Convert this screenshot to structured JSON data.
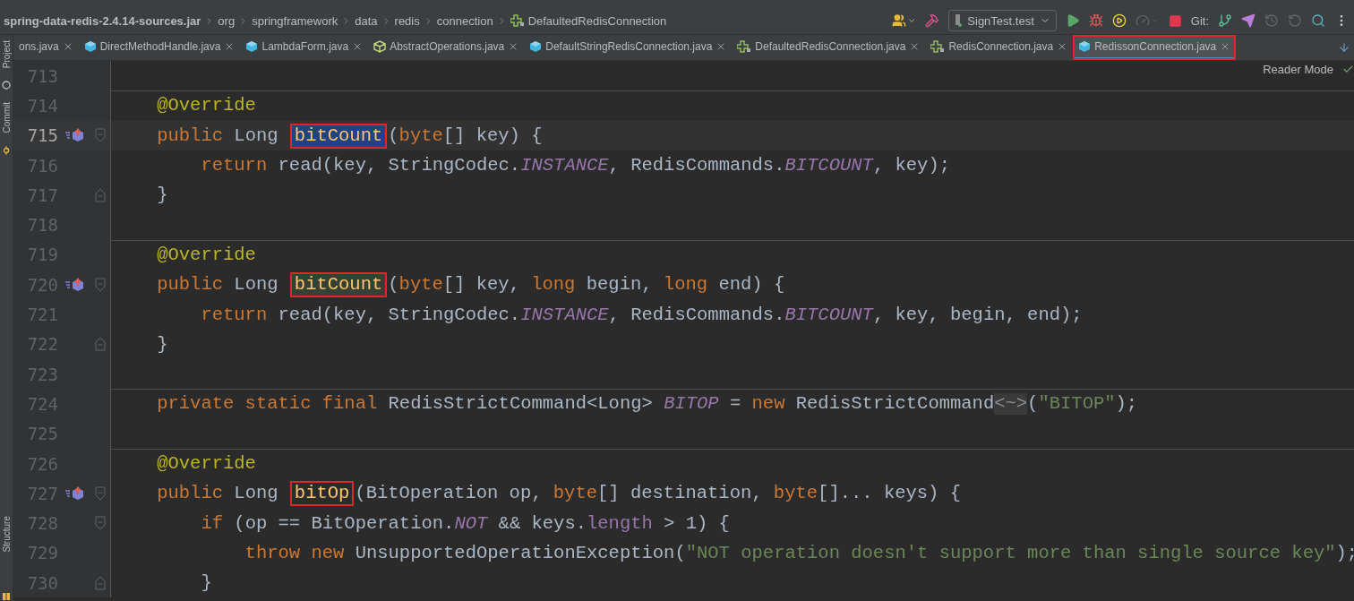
{
  "tool_strip": [
    {
      "label": "Project",
      "kind": "project"
    },
    {
      "label": "Commit",
      "kind": "commit"
    },
    {
      "label": "Structure",
      "kind": "structure"
    }
  ],
  "breadcrumbs": [
    {
      "label": "spring-data-redis-2.4.14-sources.jar",
      "kind": "jar"
    },
    {
      "label": "org",
      "kind": "package"
    },
    {
      "label": "springframework",
      "kind": "package"
    },
    {
      "label": "data",
      "kind": "package"
    },
    {
      "label": "redis",
      "kind": "package"
    },
    {
      "label": "connection",
      "kind": "package"
    },
    {
      "label": "DefaultedRedisConnection",
      "kind": "interface"
    }
  ],
  "toolbar": [
    {
      "kind": "users",
      "disabled": false
    },
    {
      "kind": "build",
      "disabled": false
    },
    {
      "kind": "run_config",
      "label": "SignTest.test",
      "disabled": false
    },
    {
      "kind": "run",
      "disabled": false
    },
    {
      "kind": "debug",
      "disabled": false
    },
    {
      "kind": "coverage",
      "disabled": false
    },
    {
      "kind": "profile",
      "disabled": true
    },
    {
      "kind": "stop",
      "disabled": false
    },
    {
      "kind": "git_label",
      "label": "Git:",
      "disabled": false
    },
    {
      "kind": "branch",
      "disabled": false
    },
    {
      "kind": "push",
      "disabled": false
    },
    {
      "kind": "history",
      "disabled": true
    },
    {
      "kind": "rollback",
      "disabled": true
    },
    {
      "kind": "search",
      "disabled": false
    },
    {
      "kind": "more",
      "disabled": false
    }
  ],
  "tabs": [
    {
      "label": "ons.java",
      "kind": "plain",
      "selected": false,
      "boxed": false
    },
    {
      "label": "DirectMethodHandle.java",
      "kind": "class",
      "selected": false,
      "boxed": false
    },
    {
      "label": "LambdaForm.java",
      "kind": "class",
      "selected": false,
      "boxed": false
    },
    {
      "label": "AbstractOperations.java",
      "kind": "abstract",
      "selected": false,
      "boxed": false
    },
    {
      "label": "DefaultStringRedisConnection.java",
      "kind": "class",
      "selected": false,
      "boxed": false
    },
    {
      "label": "DefaultedRedisConnection.java",
      "kind": "interface",
      "selected": false,
      "boxed": false
    },
    {
      "label": "RedisConnection.java",
      "kind": "interface",
      "selected": false,
      "boxed": false
    },
    {
      "label": "RedissonConnection.java",
      "kind": "class",
      "selected": true,
      "boxed": true
    }
  ],
  "reader_mode": "Reader Mode",
  "lines": [
    {
      "number": "713",
      "current": false,
      "separator_above": false,
      "implements": false,
      "fold_start": false,
      "fold_end": false
    },
    {
      "number": "714",
      "current": false,
      "separator_above": true,
      "implements": false,
      "fold_start": false,
      "fold_end": false,
      "tokens": [
        {
          "kind": "annotation",
          "text": "    @Override",
          "boxed": false
        }
      ]
    },
    {
      "number": "715",
      "current": true,
      "separator_above": false,
      "implements": true,
      "fold_start": true,
      "fold_end": false,
      "tokens": [
        {
          "kind": "keyword",
          "text": "    public ",
          "boxed": false
        },
        {
          "kind": "plain",
          "text": "Long ",
          "boxed": false
        },
        {
          "kind": "method_selected",
          "text": "bitCount",
          "boxed": true
        },
        {
          "kind": "plain",
          "text": "(",
          "boxed": false
        },
        {
          "kind": "keyword",
          "text": "byte",
          "boxed": false
        },
        {
          "kind": "plain",
          "text": "[] key) {",
          "boxed": false
        }
      ]
    },
    {
      "number": "716",
      "current": false,
      "separator_above": false,
      "implements": false,
      "fold_start": false,
      "fold_end": false,
      "tokens": [
        {
          "kind": "keyword",
          "text": "        return ",
          "boxed": false
        },
        {
          "kind": "plain",
          "text": "read(key, StringCodec.",
          "boxed": false
        },
        {
          "kind": "static",
          "text": "INSTANCE",
          "boxed": false
        },
        {
          "kind": "plain",
          "text": ", RedisCommands.",
          "boxed": false
        },
        {
          "kind": "static",
          "text": "BITCOUNT",
          "boxed": false
        },
        {
          "kind": "plain",
          "text": ", key);",
          "boxed": false
        }
      ]
    },
    {
      "number": "717",
      "current": false,
      "separator_above": false,
      "implements": false,
      "fold_start": false,
      "fold_end": true,
      "tokens": [
        {
          "kind": "plain",
          "text": "    }",
          "boxed": false
        }
      ]
    },
    {
      "number": "718",
      "current": false,
      "separator_above": false,
      "implements": false,
      "fold_start": false,
      "fold_end": false
    },
    {
      "number": "719",
      "current": false,
      "separator_above": true,
      "implements": false,
      "fold_start": false,
      "fold_end": false,
      "tokens": [
        {
          "kind": "annotation",
          "text": "    @Override",
          "boxed": false
        }
      ]
    },
    {
      "number": "720",
      "current": false,
      "separator_above": false,
      "implements": true,
      "fold_start": true,
      "fold_end": false,
      "tokens": [
        {
          "kind": "keyword",
          "text": "    public ",
          "boxed": false
        },
        {
          "kind": "plain",
          "text": "Long ",
          "boxed": false
        },
        {
          "kind": "method_usage",
          "text": "bitCount",
          "boxed": true
        },
        {
          "kind": "plain",
          "text": "(",
          "boxed": false
        },
        {
          "kind": "keyword",
          "text": "byte",
          "boxed": false
        },
        {
          "kind": "plain",
          "text": "[] key, ",
          "boxed": false
        },
        {
          "kind": "keyword",
          "text": "long ",
          "boxed": false
        },
        {
          "kind": "plain",
          "text": "begin, ",
          "boxed": false
        },
        {
          "kind": "keyword",
          "text": "long ",
          "boxed": false
        },
        {
          "kind": "plain",
          "text": "end) {",
          "boxed": false
        }
      ]
    },
    {
      "number": "721",
      "current": false,
      "separator_above": false,
      "implements": false,
      "fold_start": false,
      "fold_end": false,
      "tokens": [
        {
          "kind": "keyword",
          "text": "        return ",
          "boxed": false
        },
        {
          "kind": "plain",
          "text": "read(key, StringCodec.",
          "boxed": false
        },
        {
          "kind": "static",
          "text": "INSTANCE",
          "boxed": false
        },
        {
          "kind": "plain",
          "text": ", RedisCommands.",
          "boxed": false
        },
        {
          "kind": "static",
          "text": "BITCOUNT",
          "boxed": false
        },
        {
          "kind": "plain",
          "text": ", key, begin, end);",
          "boxed": false
        }
      ]
    },
    {
      "number": "722",
      "current": false,
      "separator_above": false,
      "implements": false,
      "fold_start": false,
      "fold_end": true,
      "tokens": [
        {
          "kind": "plain",
          "text": "    }",
          "boxed": false
        }
      ]
    },
    {
      "number": "723",
      "current": false,
      "separator_above": false,
      "implements": false,
      "fold_start": false,
      "fold_end": false
    },
    {
      "number": "724",
      "current": false,
      "separator_above": true,
      "implements": false,
      "fold_start": false,
      "fold_end": false,
      "tokens": [
        {
          "kind": "keyword",
          "text": "    private static final ",
          "boxed": false
        },
        {
          "kind": "plain",
          "text": "RedisStrictCommand<Long> ",
          "boxed": false
        },
        {
          "kind": "static",
          "text": "BITOP",
          "boxed": false
        },
        {
          "kind": "plain",
          "text": " = ",
          "boxed": false
        },
        {
          "kind": "keyword",
          "text": "new ",
          "boxed": false
        },
        {
          "kind": "plain",
          "text": "RedisStrictCommand",
          "boxed": false
        },
        {
          "kind": "folded",
          "text": "<~>",
          "boxed": false
        },
        {
          "kind": "plain",
          "text": "(",
          "boxed": false
        },
        {
          "kind": "string",
          "text": "\"BITOP\"",
          "boxed": false
        },
        {
          "kind": "plain",
          "text": ");",
          "boxed": false
        }
      ]
    },
    {
      "number": "725",
      "current": false,
      "separator_above": false,
      "implements": false,
      "fold_start": false,
      "fold_end": false
    },
    {
      "number": "726",
      "current": false,
      "separator_above": true,
      "implements": false,
      "fold_start": false,
      "fold_end": false,
      "tokens": [
        {
          "kind": "annotation",
          "text": "    @Override",
          "boxed": false
        }
      ]
    },
    {
      "number": "727",
      "current": false,
      "separator_above": false,
      "implements": true,
      "fold_start": true,
      "fold_end": false,
      "tokens": [
        {
          "kind": "keyword",
          "text": "    public ",
          "boxed": false
        },
        {
          "kind": "plain",
          "text": "Long ",
          "boxed": false
        },
        {
          "kind": "method",
          "text": "bitOp",
          "boxed": true
        },
        {
          "kind": "plain",
          "text": "(BitOperation op, ",
          "boxed": false
        },
        {
          "kind": "keyword",
          "text": "byte",
          "boxed": false
        },
        {
          "kind": "plain",
          "text": "[] destination, ",
          "boxed": false
        },
        {
          "kind": "keyword",
          "text": "byte",
          "boxed": false
        },
        {
          "kind": "plain",
          "text": "[]... keys) {",
          "boxed": false
        }
      ]
    },
    {
      "number": "728",
      "current": false,
      "separator_above": false,
      "implements": false,
      "fold_start": true,
      "fold_end": false,
      "tokens": [
        {
          "kind": "keyword",
          "text": "        if ",
          "boxed": false
        },
        {
          "kind": "plain",
          "text": "(op == BitOperation.",
          "boxed": false
        },
        {
          "kind": "static",
          "text": "NOT",
          "boxed": false
        },
        {
          "kind": "plain",
          "text": " && keys.",
          "boxed": false
        },
        {
          "kind": "field",
          "text": "length",
          "boxed": false
        },
        {
          "kind": "plain",
          "text": " > 1) {",
          "boxed": false
        }
      ]
    },
    {
      "number": "729",
      "current": false,
      "separator_above": false,
      "implements": false,
      "fold_start": false,
      "fold_end": false,
      "tokens": [
        {
          "kind": "keyword",
          "text": "            throw new ",
          "boxed": false
        },
        {
          "kind": "plain",
          "text": "UnsupportedOperationException(",
          "boxed": false
        },
        {
          "kind": "string",
          "text": "\"NOT operation doesn't support more than single source key\"",
          "boxed": false
        },
        {
          "kind": "plain",
          "text": ");",
          "boxed": false
        }
      ]
    },
    {
      "number": "730",
      "current": false,
      "separator_above": false,
      "implements": false,
      "fold_start": false,
      "fold_end": true,
      "tokens": [
        {
          "kind": "plain",
          "text": "        }",
          "boxed": false
        }
      ]
    }
  ]
}
